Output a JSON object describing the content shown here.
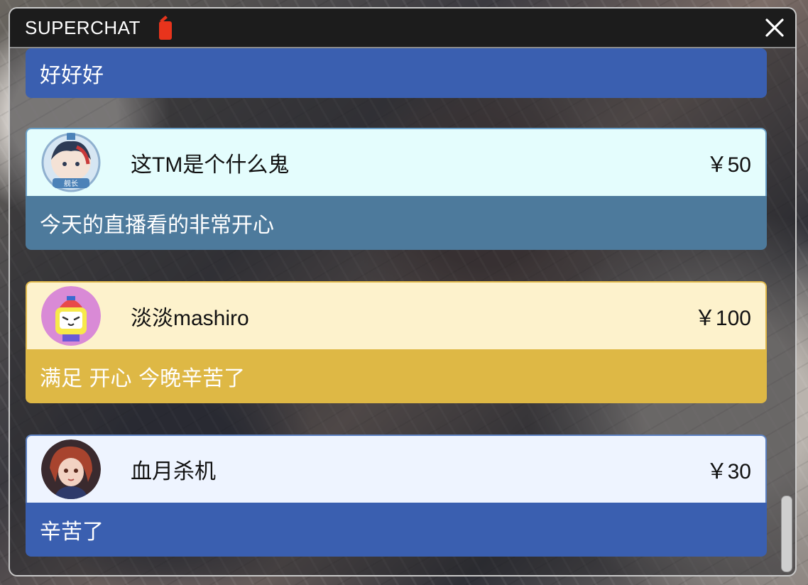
{
  "window": {
    "title": "SUPERCHAT"
  },
  "icons": {
    "title_icon": "battery-icon",
    "close": "close-icon"
  },
  "partial_card": {
    "message": "好好好",
    "color": "#3a5fb0"
  },
  "cards": [
    {
      "username": "这TM是个什么鬼",
      "price": "￥50",
      "message": "今天的直播看的非常开心",
      "header_color": "#e4fdfd",
      "header_border": "#6aa0c8",
      "body_color": "#4d7a9c",
      "avatar": "avatar-captain-badge"
    },
    {
      "username": "淡淡mashiro",
      "price": "￥100",
      "message": "满足 开心 今晚辛苦了",
      "header_color": "#fdf2cc",
      "header_border": "#e0b84a",
      "body_color": "#deb845",
      "avatar": "avatar-bilibili-tv"
    },
    {
      "username": "血月杀机",
      "price": "￥30",
      "message": "辛苦了",
      "header_color": "#eef4ff",
      "header_border": "#5a7fc0",
      "body_color": "#3a5fb0",
      "avatar": "avatar-anime-girl"
    }
  ]
}
